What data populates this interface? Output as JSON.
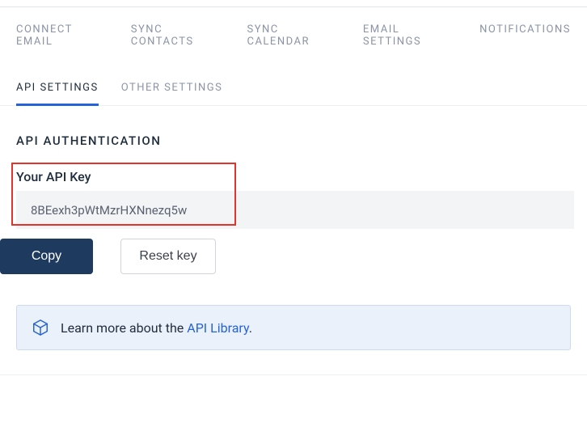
{
  "nav": {
    "items": [
      "CONNECT  EMAIL",
      "SYNC  CONTACTS",
      "SYNC  CALENDAR",
      "EMAIL  SETTINGS",
      "NOTIFICATIONS"
    ]
  },
  "subnav": {
    "items": [
      "API  SETTINGS",
      "OTHER  SETTINGS"
    ],
    "active_index": 0
  },
  "section": {
    "title": "API  AUTHENTICATION",
    "key_label": "Your API Key",
    "key_value": "8BEexh3pWtMzrHXNnezq5w"
  },
  "buttons": {
    "copy": "Copy",
    "reset": "Reset key"
  },
  "info": {
    "prefix": "Learn more about the ",
    "link": "API Library",
    "suffix": "."
  }
}
